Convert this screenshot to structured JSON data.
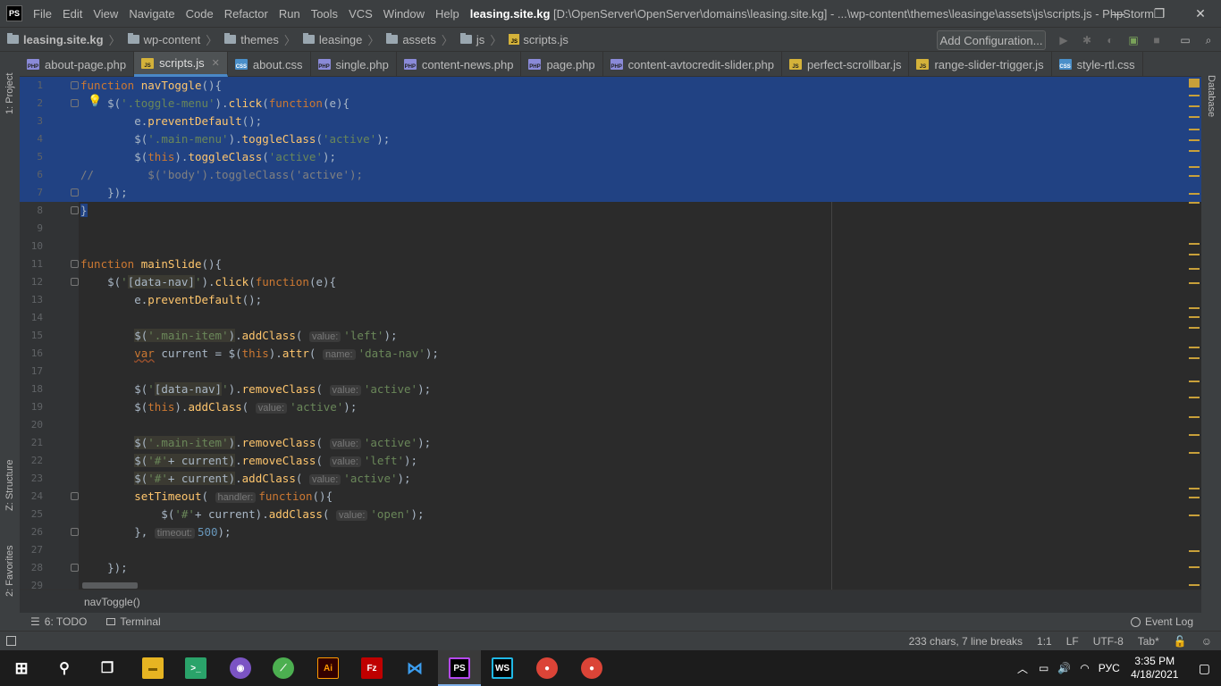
{
  "titlebar": {
    "logo": "PS",
    "menu": [
      "File",
      "Edit",
      "View",
      "Navigate",
      "Code",
      "Refactor",
      "Run",
      "Tools",
      "VCS",
      "Window",
      "Help"
    ],
    "project": "leasing.site.kg",
    "path": " [D:\\OpenServer\\OpenServer\\domains\\leasing.site.kg] - ...\\wp-content\\themes\\leasinge\\assets\\js\\scripts.js - PhpStorm"
  },
  "navbar": {
    "crumbs": [
      "leasing.site.kg",
      "wp-content",
      "themes",
      "leasinge",
      "assets",
      "js",
      "scripts.js"
    ],
    "add_config": "Add Configuration..."
  },
  "tabs": [
    {
      "label": "about-page.php",
      "type": "php",
      "active": false
    },
    {
      "label": "scripts.js",
      "type": "js",
      "active": true
    },
    {
      "label": "about.css",
      "type": "css",
      "active": false
    },
    {
      "label": "single.php",
      "type": "php",
      "active": false
    },
    {
      "label": "content-news.php",
      "type": "php",
      "active": false
    },
    {
      "label": "page.php",
      "type": "php",
      "active": false
    },
    {
      "label": "content-avtocredit-slider.php",
      "type": "php",
      "active": false
    },
    {
      "label": "perfect-scrollbar.js",
      "type": "js",
      "active": false
    },
    {
      "label": "range-slider-trigger.js",
      "type": "js",
      "active": false
    },
    {
      "label": "style-rtl.css",
      "type": "css",
      "active": false
    }
  ],
  "side_tools": {
    "project": "1: Project",
    "structure": "Z: Structure",
    "favorites": "2: Favorites",
    "database": "Database"
  },
  "code_lines": [
    "1",
    "2",
    "3",
    "4",
    "5",
    "6",
    "7",
    "8",
    "9",
    "10",
    "11",
    "12",
    "13",
    "14",
    "15",
    "16",
    "17",
    "18",
    "19",
    "20",
    "21",
    "22",
    "23",
    "24",
    "25",
    "26",
    "27",
    "28",
    "29"
  ],
  "code_crumb": "navToggle()",
  "bottom_tools": {
    "todo": "6: TODO",
    "terminal": "Terminal",
    "event_log": "Event Log"
  },
  "status": {
    "chars": "233 chars, 7 line breaks",
    "position": "1:1",
    "line_sep": "LF",
    "encoding": "UTF-8",
    "indent": "Tab*"
  },
  "taskbar": {
    "lang": "РУС",
    "time": "3:35 PM",
    "date": "4/18/2021"
  },
  "colors": {
    "selection": "#214283",
    "keyword": "#cc7832",
    "function": "#ffc66d",
    "string": "#6a8759",
    "comment": "#808080"
  }
}
